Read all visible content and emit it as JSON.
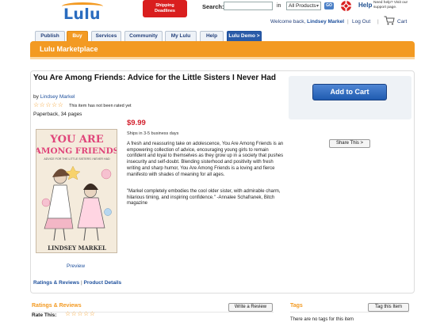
{
  "header": {
    "logo_text": "Lulu",
    "promo": {
      "line1": "Shipping",
      "line2": "Deadlines"
    },
    "search_label": "Search:",
    "search_value": "",
    "in_label": "in",
    "search_scope": "All Products",
    "go_label": "GO",
    "help_label": "Help",
    "help_sub": "Need help? Visit our support page.",
    "welcome_prefix": "Welcome back, ",
    "welcome_user": "Lindsey Markel",
    "logout_label": "Log Out",
    "cart_label": "Cart"
  },
  "tabs": [
    {
      "label": "Publish"
    },
    {
      "label": "Buy",
      "active": true
    },
    {
      "label": "Services"
    },
    {
      "label": "Community"
    },
    {
      "label": "My Lulu"
    },
    {
      "label": "Help"
    },
    {
      "label": "Lulu Demo >"
    }
  ],
  "marketplace": {
    "title": "Lulu Marketplace"
  },
  "product": {
    "title": "You Are Among Friends: Advice for the Little Sisters I Never Had",
    "by_label": "by ",
    "author": "Lindsey Markel",
    "rating_stars": "☆☆☆☆☆",
    "rating_note": "This item has not been rated yet",
    "format": "Paperback, 34 pages",
    "price": "$9.99",
    "ships": "Ships in 3-5 business days",
    "description": "A fresh and reassuring take on adolescence, You Are Among Friends is an empowering collection of advice, encouraging young girls to remain confident and loyal to themselves as they grow up in a society that pushes insecurity and self-doubt. Blending sisterhood and positivity with fresh writing and sharp humor, You Are Among Friends is a loving and fierce manifesto with shades of meaning for all ages.",
    "quote": "\"Markel completely embodies the cool older sister, with admirable charm, hilarious timing, and inspiring confidence.\" -Annalee Schafranek, Bitch magazine",
    "preview_label": "Preview",
    "cover": {
      "title_line1": "YOU ARE",
      "title_line2": "AMONG FRIENDS",
      "subtitle": "ADVICE FOR THE LITTLE SISTERS I NEVER HAD",
      "author": "LINDSEY MARKEL"
    }
  },
  "actions": {
    "add_to_cart": "Add to Cart",
    "share": "Share This >"
  },
  "links": {
    "ratings": "Ratings & Reviews",
    "sep": " | ",
    "details": "Product Details"
  },
  "reviews": {
    "title": "Ratings & Reviews",
    "write_review": "Write a Review",
    "rate_this": "Rate This:",
    "rate_stars": "☆☆☆☆☆"
  },
  "tags": {
    "title": "Tags",
    "tag_button": "Tag this Item",
    "empty": "There are no tags for this item"
  },
  "colors": {
    "brand_orange": "#f39a22",
    "link_blue": "#1d4f9c",
    "price_red": "#d21e2b"
  }
}
